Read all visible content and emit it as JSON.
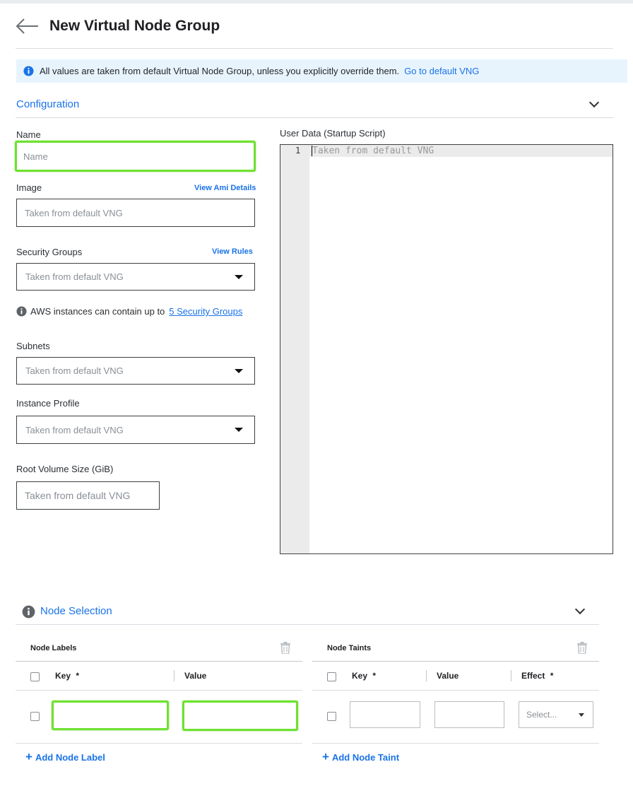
{
  "header": {
    "title": "New Virtual Node Group"
  },
  "info_bar": {
    "text": "All values are taken from default Virtual Node Group, unless you explicitly override them.",
    "link": "Go to default VNG"
  },
  "configuration": {
    "title": "Configuration",
    "name": {
      "label": "Name",
      "placeholder": "Name"
    },
    "image": {
      "label": "Image",
      "link": "View Ami Details",
      "placeholder": "Taken from default VNG"
    },
    "security_groups": {
      "label": "Security Groups",
      "link": "View Rules",
      "value": "Taken from default VNG",
      "note_text": "AWS instances can contain up to",
      "note_link": "5 Security Groups"
    },
    "subnets": {
      "label": "Subnets",
      "value": "Taken from default VNG"
    },
    "instance_profile": {
      "label": "Instance Profile",
      "value": "Taken from default VNG"
    },
    "root_volume": {
      "label": "Root Volume Size (GiB)",
      "placeholder": "Taken from default VNG"
    },
    "user_data": {
      "label": "User Data (Startup Script)",
      "line_number": "1",
      "placeholder": "Taken from default VNG"
    }
  },
  "node_selection": {
    "title": "Node Selection",
    "labels": {
      "title": "Node Labels",
      "col_key": "Key",
      "col_value": "Value",
      "required_mark": "*",
      "add": "Add Node Label"
    },
    "taints": {
      "title": "Node Taints",
      "col_key": "Key",
      "col_value": "Value",
      "col_effect": "Effect",
      "required_mark": "*",
      "effect_placeholder": "Select...",
      "add": "Add Node Taint"
    }
  },
  "colors": {
    "accent": "#1a73e8",
    "highlight": "#6ee131",
    "info_bg": "#e8f4fd"
  }
}
